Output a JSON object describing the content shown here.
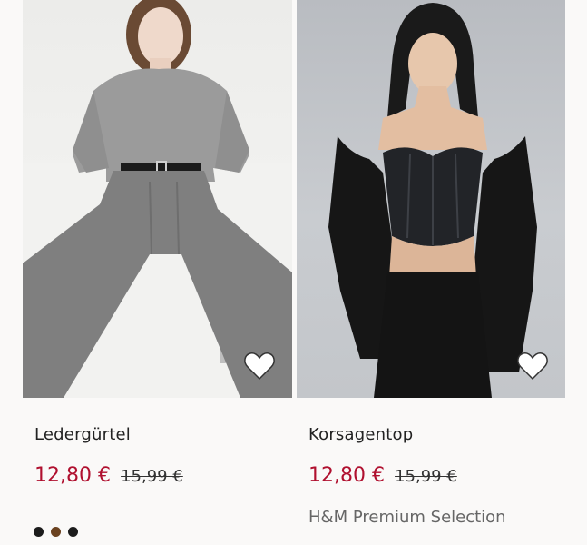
{
  "products": [
    {
      "name": "Ledergürtel",
      "price": "12,80 €",
      "old_price": "15,99 €",
      "image_icon": "product-photo",
      "favorite_icon": "heart-icon",
      "swatches": [
        "#1c1c1c",
        "#6b4220",
        "#1c1c1c"
      ]
    },
    {
      "name": "Korsagentop",
      "price": "12,80 €",
      "old_price": "15,99 €",
      "brand": "H&M Premium Selection",
      "image_icon": "product-photo",
      "favorite_icon": "heart-icon"
    }
  ],
  "colors": {
    "sale_price": "#b0102f",
    "background": "#faf9f8"
  }
}
